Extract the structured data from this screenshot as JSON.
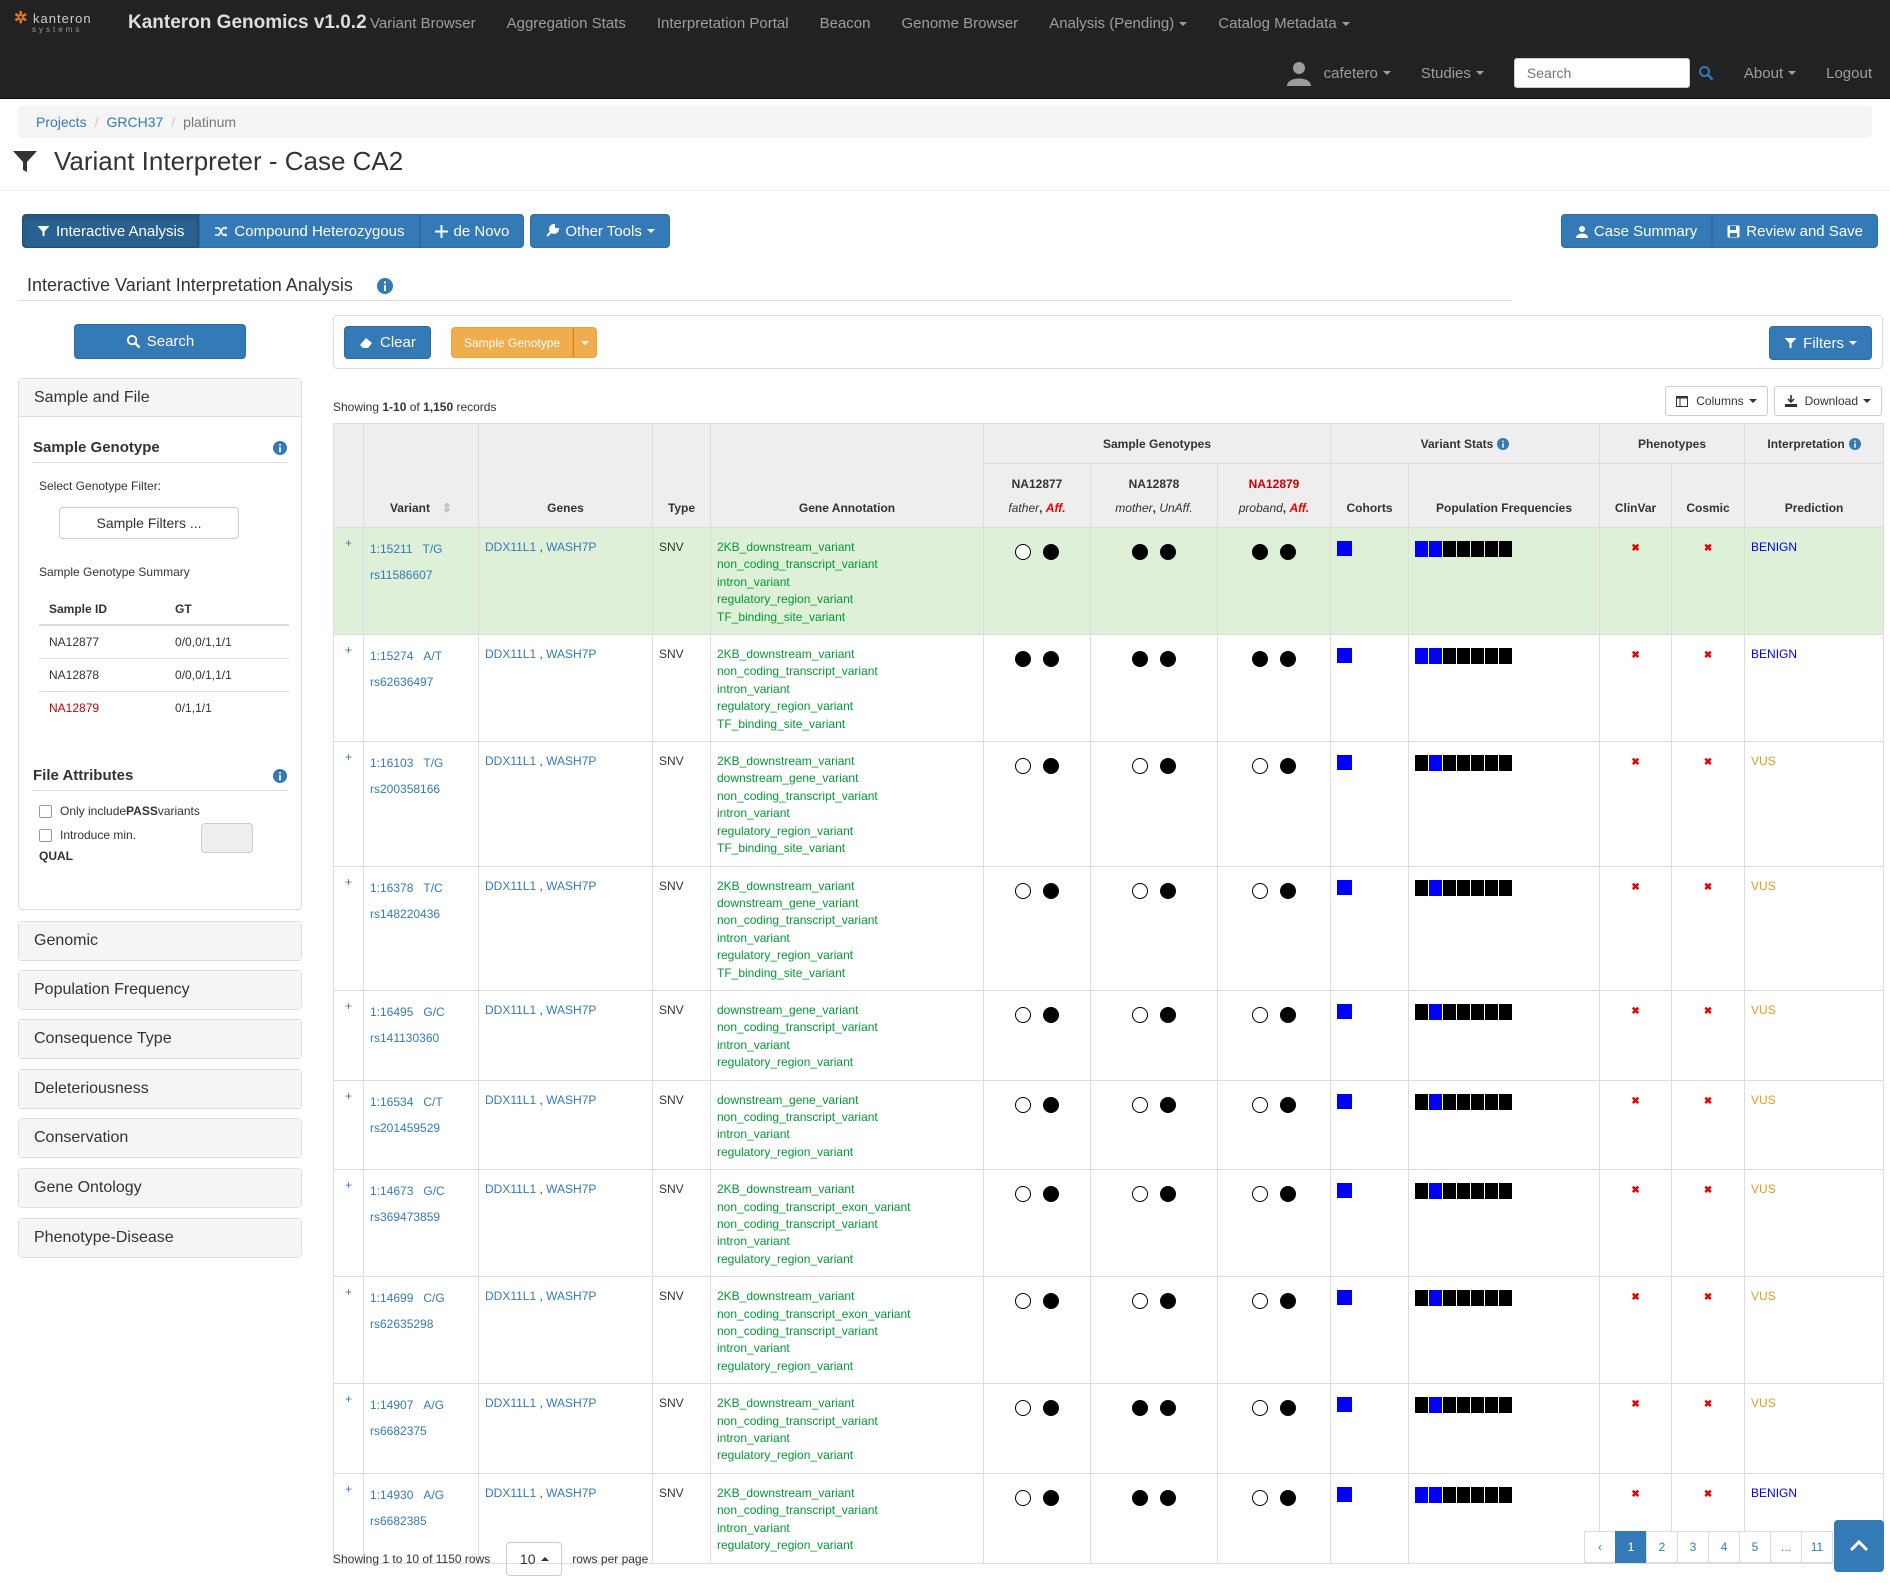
{
  "brand": {
    "logo_main": "kanteron",
    "logo_sub": "systems",
    "title": "Kanteron Genomics v1.0.2"
  },
  "nav": {
    "top": [
      "Variant Browser",
      "Aggregation Stats",
      "Interpretation Portal",
      "Beacon",
      "Genome Browser",
      "Analysis (Pending)",
      "Catalog Metadata"
    ],
    "user": "cafetero",
    "studies": "Studies",
    "search_placeholder": "Search",
    "about": "About",
    "logout": "Logout"
  },
  "breadcrumb": [
    "Projects",
    "GRCH37",
    "platinum"
  ],
  "page_title": "Variant Interpreter - Case CA2",
  "tools": {
    "interactive": "Interactive Analysis",
    "compound": "Compound Heterozygous",
    "denovo": "de Novo",
    "other": "Other Tools",
    "case_summary": "Case Summary",
    "review_save": "Review and Save"
  },
  "section_title": "Interactive Variant Interpretation Analysis",
  "left": {
    "search": "Search",
    "sample_file": "Sample and File",
    "sample_genotype": "Sample Genotype",
    "select_filter": "Select Genotype Filter:",
    "sample_filters": "Sample Filters ...",
    "summary": "Sample Genotype Summary",
    "summary_headers": [
      "Sample ID",
      "GT"
    ],
    "summary_rows": [
      {
        "id": "NA12877",
        "gt": "0/0,0/1,1/1"
      },
      {
        "id": "NA12878",
        "gt": "0/0,0/1,1/1"
      },
      {
        "id": "NA12879",
        "gt": "0/1,1/1"
      }
    ],
    "file_attributes": "File Attributes",
    "only_pass_prefix": "Only include ",
    "only_pass_bold": "PASS",
    "only_pass_suffix": " variants",
    "intro_min": "Introduce min.",
    "qual": "QUAL",
    "collapsed": [
      "Genomic",
      "Population Frequency",
      "Consequence Type",
      "Deleteriousness",
      "Conservation",
      "Gene Ontology",
      "Phenotype-Disease"
    ]
  },
  "filterbar": {
    "clear": "Clear",
    "sample_genotype": "Sample Genotype",
    "filters": "Filters"
  },
  "table_info": {
    "prefix": "Showing ",
    "range": "1-10",
    "of": " of ",
    "total": "1,150",
    "suffix": " records",
    "columns": "Columns",
    "download": "Download"
  },
  "table_headers": {
    "variant": "Variant",
    "genes": "Genes",
    "type": "Type",
    "gene_annotation": "Gene Annotation",
    "sample_genotypes": "Sample Genotypes",
    "variant_stats": "Variant Stats",
    "phenotypes": "Phenotypes",
    "interpretation": "Interpretation",
    "samples": [
      {
        "id": "NA12877",
        "role": "father",
        "status": "Aff."
      },
      {
        "id": "NA12878",
        "role": "mother",
        "status": "UnAff."
      },
      {
        "id": "NA12879",
        "role": "proband",
        "status": "Aff."
      }
    ],
    "cohorts": "Cohorts",
    "pop_freq": "Population Frequencies",
    "clinvar": "ClinVar",
    "cosmic": "Cosmic",
    "prediction": "Prediction"
  },
  "variants": [
    {
      "pos": "1:15211",
      "alleles": "T/G",
      "rs": "rs11586607",
      "genes": [
        "DDX11L1",
        "WASH7P"
      ],
      "type": "SNV",
      "ann": [
        "2KB_downstream_variant",
        "non_coding_transcript_variant",
        "intron_variant",
        "regulatory_region_variant",
        "TF_binding_site_variant"
      ],
      "gts": [
        [
          "e",
          "f"
        ],
        [
          "f",
          "f"
        ],
        [
          "f",
          "f"
        ]
      ],
      "pf": [
        "#00f",
        "#00f",
        "#000",
        "#000",
        "#000",
        "#000",
        "#000"
      ],
      "pred": "BENIGN",
      "highlight": true
    },
    {
      "pos": "1:15274",
      "alleles": "A/T",
      "rs": "rs62636497",
      "genes": [
        "DDX11L1",
        "WASH7P"
      ],
      "type": "SNV",
      "ann": [
        "2KB_downstream_variant",
        "non_coding_transcript_variant",
        "intron_variant",
        "regulatory_region_variant",
        "TF_binding_site_variant"
      ],
      "gts": [
        [
          "f",
          "f"
        ],
        [
          "f",
          "f"
        ],
        [
          "f",
          "f"
        ]
      ],
      "pf": [
        "#00f",
        "#00f",
        "#000",
        "#000",
        "#000",
        "#000",
        "#000"
      ],
      "pred": "BENIGN"
    },
    {
      "pos": "1:16103",
      "alleles": "T/G",
      "rs": "rs200358166",
      "genes": [
        "DDX11L1",
        "WASH7P"
      ],
      "type": "SNV",
      "ann": [
        "2KB_downstream_variant",
        "downstream_gene_variant",
        "non_coding_transcript_variant",
        "intron_variant",
        "regulatory_region_variant",
        "TF_binding_site_variant"
      ],
      "gts": [
        [
          "e",
          "f"
        ],
        [
          "e",
          "f"
        ],
        [
          "e",
          "f"
        ]
      ],
      "pf": [
        "#000",
        "#00f",
        "#000",
        "#000",
        "#000",
        "#000",
        "#000"
      ],
      "pred": "VUS"
    },
    {
      "pos": "1:16378",
      "alleles": "T/C",
      "rs": "rs148220436",
      "genes": [
        "DDX11L1",
        "WASH7P"
      ],
      "type": "SNV",
      "ann": [
        "2KB_downstream_variant",
        "downstream_gene_variant",
        "non_coding_transcript_variant",
        "intron_variant",
        "regulatory_region_variant",
        "TF_binding_site_variant"
      ],
      "gts": [
        [
          "e",
          "f"
        ],
        [
          "e",
          "f"
        ],
        [
          "e",
          "f"
        ]
      ],
      "pf": [
        "#000",
        "#00f",
        "#000",
        "#000",
        "#000",
        "#000",
        "#000"
      ],
      "pred": "VUS"
    },
    {
      "pos": "1:16495",
      "alleles": "G/C",
      "rs": "rs141130360",
      "genes": [
        "DDX11L1",
        "WASH7P"
      ],
      "type": "SNV",
      "ann": [
        "downstream_gene_variant",
        "non_coding_transcript_variant",
        "intron_variant",
        "regulatory_region_variant"
      ],
      "gts": [
        [
          "e",
          "f"
        ],
        [
          "e",
          "f"
        ],
        [
          "e",
          "f"
        ]
      ],
      "pf": [
        "#000",
        "#00f",
        "#000",
        "#000",
        "#000",
        "#000",
        "#000"
      ],
      "pred": "VUS"
    },
    {
      "pos": "1:16534",
      "alleles": "C/T",
      "rs": "rs201459529",
      "genes": [
        "DDX11L1",
        "WASH7P"
      ],
      "type": "SNV",
      "ann": [
        "downstream_gene_variant",
        "non_coding_transcript_variant",
        "intron_variant",
        "regulatory_region_variant"
      ],
      "gts": [
        [
          "e",
          "f"
        ],
        [
          "e",
          "f"
        ],
        [
          "e",
          "f"
        ]
      ],
      "pf": [
        "#000",
        "#00f",
        "#000",
        "#000",
        "#000",
        "#000",
        "#000"
      ],
      "pred": "VUS"
    },
    {
      "pos": "1:14673",
      "alleles": "G/C",
      "rs": "rs369473859",
      "genes": [
        "DDX11L1",
        "WASH7P"
      ],
      "type": "SNV",
      "ann": [
        "2KB_downstream_variant",
        "non_coding_transcript_exon_variant",
        "non_coding_transcript_variant",
        "intron_variant",
        "regulatory_region_variant"
      ],
      "gts": [
        [
          "e",
          "f"
        ],
        [
          "e",
          "f"
        ],
        [
          "e",
          "f"
        ]
      ],
      "pf": [
        "#000",
        "#00f",
        "#000",
        "#000",
        "#000",
        "#000",
        "#000"
      ],
      "pred": "VUS"
    },
    {
      "pos": "1:14699",
      "alleles": "C/G",
      "rs": "rs62635298",
      "genes": [
        "DDX11L1",
        "WASH7P"
      ],
      "type": "SNV",
      "ann": [
        "2KB_downstream_variant",
        "non_coding_transcript_exon_variant",
        "non_coding_transcript_variant",
        "intron_variant",
        "regulatory_region_variant"
      ],
      "gts": [
        [
          "e",
          "f"
        ],
        [
          "e",
          "f"
        ],
        [
          "e",
          "f"
        ]
      ],
      "pf": [
        "#000",
        "#00f",
        "#000",
        "#000",
        "#000",
        "#000",
        "#000"
      ],
      "pred": "VUS"
    },
    {
      "pos": "1:14907",
      "alleles": "A/G",
      "rs": "rs6682375",
      "genes": [
        "DDX11L1",
        "WASH7P"
      ],
      "type": "SNV",
      "ann": [
        "2KB_downstream_variant",
        "non_coding_transcript_variant",
        "intron_variant",
        "regulatory_region_variant"
      ],
      "gts": [
        [
          "e",
          "f"
        ],
        [
          "f",
          "f"
        ],
        [
          "e",
          "f"
        ]
      ],
      "pf": [
        "#000",
        "#00f",
        "#000",
        "#000",
        "#000",
        "#000",
        "#000"
      ],
      "pred": "VUS"
    },
    {
      "pos": "1:14930",
      "alleles": "A/G",
      "rs": "rs6682385",
      "genes": [
        "DDX11L1",
        "WASH7P"
      ],
      "type": "SNV",
      "ann": [
        "2KB_downstream_variant",
        "non_coding_transcript_variant",
        "intron_variant",
        "regulatory_region_variant"
      ],
      "gts": [
        [
          "e",
          "f"
        ],
        [
          "f",
          "f"
        ],
        [
          "e",
          "f"
        ]
      ],
      "pf": [
        "#00f",
        "#00f",
        "#000",
        "#000",
        "#000",
        "#000",
        "#000"
      ],
      "pred": "BENIGN"
    }
  ],
  "bottom": {
    "showing": "Showing 1 to 10 of 1150 rows",
    "rows_per_page_value": "10",
    "rows_per_page": "rows per page",
    "pages": [
      "‹",
      "1",
      "2",
      "3",
      "4",
      "5",
      "...",
      "11"
    ],
    "active_page": "1"
  },
  "colors": {
    "accent": "#337ab7",
    "warning": "#f0ad4e",
    "highlight_row": "#dff0d8",
    "annotation": "#009933",
    "benign": "#0000ff",
    "vus": "#e89a1a",
    "affected": "#ee0000",
    "navbar": "#222222"
  }
}
